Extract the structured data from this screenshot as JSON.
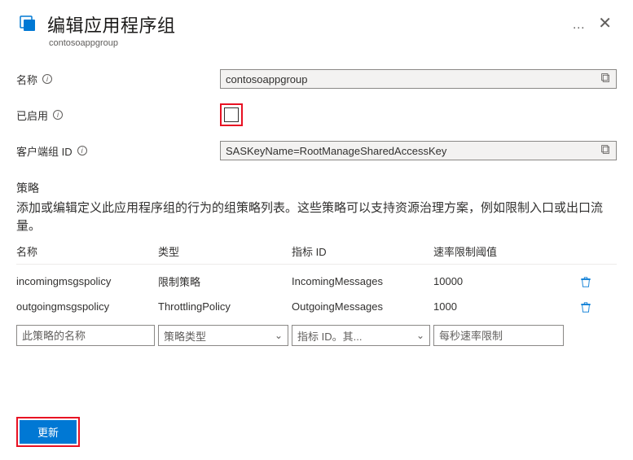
{
  "header": {
    "title": "编辑应用程序组",
    "subtitle": "contosoappgroup"
  },
  "fields": {
    "name": {
      "label": "名称",
      "value": "contosoappgroup"
    },
    "enabled": {
      "label": "已启用"
    },
    "clientGroupId": {
      "label": "客户端组 ID",
      "value": "SASKeyName=RootManageSharedAccessKey"
    }
  },
  "policies": {
    "sectionTitle": "策略",
    "description": "添加或编辑定义此应用程序组的行为的组策略列表。这些策略可以支持资源治理方案，例如限制入口或出口流量。",
    "headers": {
      "name": "名称",
      "type": "类型",
      "metricId": "指标 ID",
      "rateLimit": "速率限制阈值"
    },
    "rows": [
      {
        "name": "incomingmsgspolicy",
        "type": "限制策略",
        "metricId": "IncomingMessages",
        "rateLimit": "10000"
      },
      {
        "name": "outgoingmsgspolicy",
        "type": "ThrottlingPolicy",
        "metricId": "OutgoingMessages",
        "rateLimit": "1000"
      }
    ],
    "inputs": {
      "namePlaceholder": "此策略的名称",
      "typePlaceholder": "策略类型",
      "metricPlaceholder": "指标 ID。其...",
      "ratePlaceholder": "每秒速率限制"
    }
  },
  "footer": {
    "updateLabel": "更新"
  }
}
